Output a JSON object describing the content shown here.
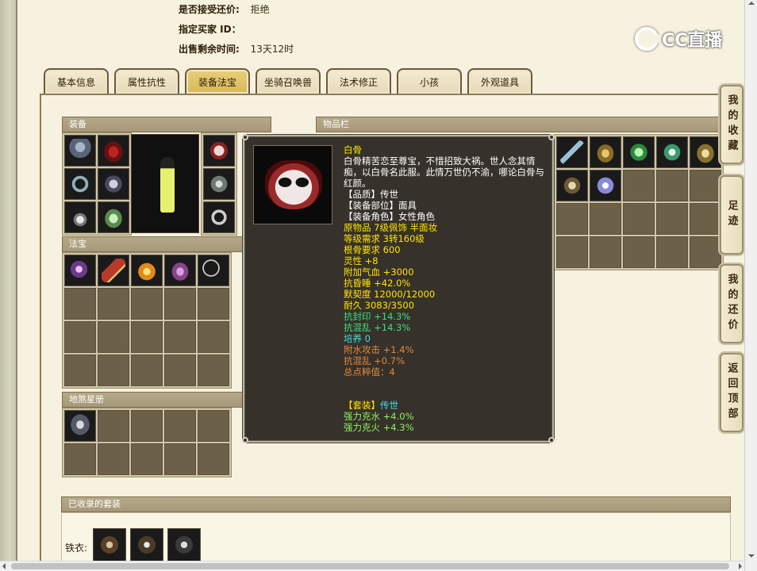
{
  "header": {
    "accept_counter_label": "是否接受还价:",
    "accept_counter_value": "拒绝",
    "buyer_id_label": "指定买家 ID：",
    "time_left_label": "出售剩余时间:",
    "time_left_value": "13天12时"
  },
  "logo": {
    "text": "CC直播"
  },
  "tabs": [
    {
      "label": "基本信息",
      "active": false
    },
    {
      "label": "属性抗性",
      "active": false
    },
    {
      "label": "装备法宝",
      "active": true
    },
    {
      "label": "坐骑召唤兽",
      "active": false
    },
    {
      "label": "法术修正",
      "active": false
    },
    {
      "label": "小孩",
      "active": false
    },
    {
      "label": "外观道具",
      "active": false
    }
  ],
  "panels": {
    "equipment": "装备",
    "inventory": "物品栏",
    "treasure": "法宝",
    "star_book": "地煞星册",
    "collected_sets": "已收录的套装"
  },
  "sets": {
    "label": "铁衣:"
  },
  "tooltip": {
    "name": "白骨",
    "desc_line1": "白骨精苦恋至尊宝，不惜招致大祸。世人念其情",
    "desc_line2": "痴，以白骨名此服。此情万世仍不渝，哪论白骨与",
    "desc_line3": "红颜。",
    "quality": "【品质】传世",
    "slot": "【装备部位】面具",
    "role": "【装备角色】女性角色",
    "origin": "原物品 7级佩饰 半面妆",
    "level_req": "等级需求 3转160级",
    "bone_req": "根骨要求 600",
    "spirit": "灵性 +8",
    "hp": "附加气血 +3000",
    "anti_sleep": "抗昏睡 +42.0%",
    "tacit": "默契度 12000/12000",
    "durability": "耐久 3083/3500",
    "anti_seal": "抗封印 +14.3%",
    "anti_chaos": "抗混乱 +14.3%",
    "cultivate": "培养 0",
    "water_atk": "附水攻击 +1.4%",
    "anti_chaos2": "抗混乱 +0.7%",
    "total_value": "总点粹值：4",
    "set_label": "【套装】",
    "set_name": "传世",
    "set_bonus1": "强力克水 +4.0%",
    "set_bonus2": "强力克火 +4.3%"
  },
  "side_buttons": [
    {
      "label": "我的收藏"
    },
    {
      "label": "足迹"
    },
    {
      "label": "我的还价"
    },
    {
      "label": "返回顶部"
    }
  ],
  "colors": {
    "tooltip_bg": "#36312a",
    "title_yellow": "#ffe400",
    "stat_green": "#3ce07a",
    "stat_cyan": "#3fe0e0",
    "stat_orange": "#e08a40",
    "tab_active": "#d8b75a"
  }
}
